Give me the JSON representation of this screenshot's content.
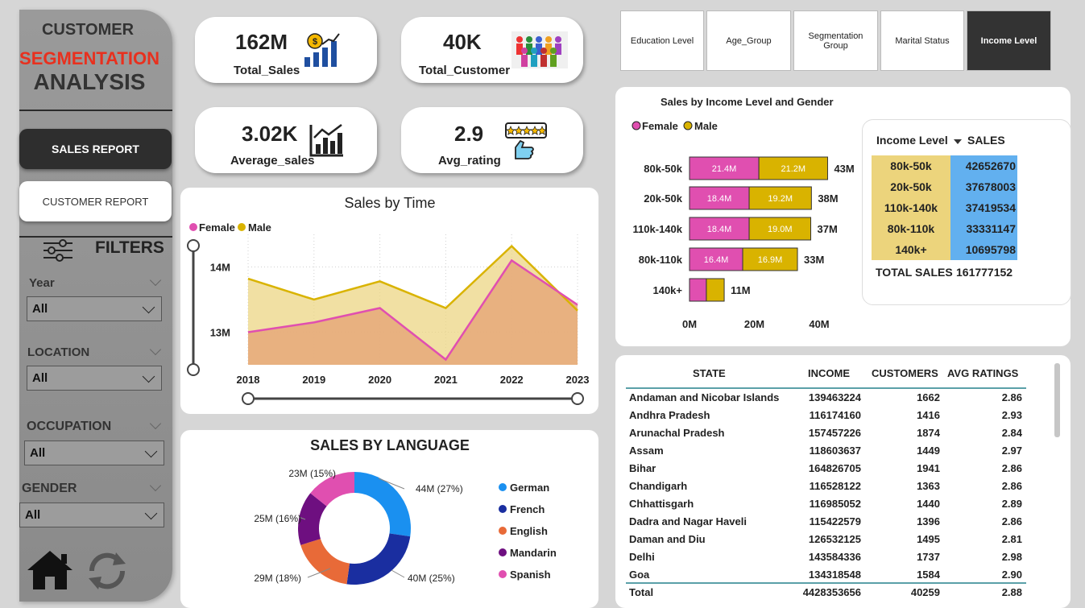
{
  "sidebar": {
    "title_line1": "CUSTOMER",
    "title_line2": "SEGMENTATION",
    "title_line3": "ANALYSIS",
    "sales_report": "SALES REPORT",
    "customer_report": "CUSTOMER REPORT",
    "filters": "FILTERS",
    "slicers": [
      {
        "label": "Year",
        "value": "All"
      },
      {
        "label": "LOCATION",
        "value": "All"
      },
      {
        "label": "OCCUPATION",
        "value": "All"
      },
      {
        "label": "GENDER",
        "value": "All"
      }
    ],
    "icons": [
      "home-icon",
      "refresh-icon",
      "sliders-icon"
    ]
  },
  "kpis": [
    {
      "value": "162M",
      "label": "Total_Sales",
      "icon": "money-growth-icon"
    },
    {
      "value": "40K",
      "label": "Total_Customer",
      "icon": "crowd-icon"
    },
    {
      "value": "3.02K",
      "label": "Average_sales",
      "icon": "bar-growth-icon"
    },
    {
      "value": "2.9",
      "label": "Avg_rating",
      "icon": "rating-hand-icon"
    }
  ],
  "tabs": [
    {
      "label": "Education Level",
      "active": false
    },
    {
      "label": "Age_Group",
      "active": false
    },
    {
      "label": "Segmentation Group",
      "active": false
    },
    {
      "label": "Marital Status",
      "active": false
    },
    {
      "label": "Income Level",
      "active": true
    }
  ],
  "colors": {
    "female": "#e04fb0",
    "male": "#d9b300",
    "highlight_yellow": "#ecd47c",
    "highlight_blue": "#62b0ef",
    "accent_red": "#e8301e"
  },
  "chart_data": [
    {
      "type": "area",
      "title": "Sales by Time",
      "series": [
        {
          "name": "Female",
          "values": [
            13.0,
            13.15,
            13.37,
            12.58,
            14.1,
            13.42
          ]
        },
        {
          "name": "Male",
          "values": [
            13.82,
            13.5,
            13.78,
            13.37,
            14.32,
            13.33
          ]
        }
      ],
      "x": [
        "2018",
        "2019",
        "2020",
        "2021",
        "2022",
        "2023"
      ],
      "yticks": [
        "13M",
        "14M"
      ],
      "ylim": [
        12.5,
        14.5
      ],
      "legend": "top-left"
    },
    {
      "type": "bar",
      "title": "Sales by Income Level and Gender",
      "categories": [
        "80k-50k",
        "20k-50k",
        "110k-140k",
        "80k-110k",
        "140k+"
      ],
      "series": [
        {
          "name": "Female",
          "values": [
            21.4,
            18.4,
            18.4,
            16.4,
            5.2
          ],
          "labels": [
            "21.4M",
            "18.4M",
            "18.4M",
            "16.4M",
            ""
          ]
        },
        {
          "name": "Male",
          "values": [
            21.2,
            19.2,
            19.0,
            16.9,
            5.5
          ],
          "labels": [
            "21.2M",
            "19.2M",
            "19.0M",
            "16.9M",
            ""
          ]
        }
      ],
      "totals": [
        "43M",
        "38M",
        "37M",
        "33M",
        "11M"
      ],
      "xticks": [
        "0M",
        "20M",
        "40M"
      ],
      "xlim": [
        0,
        50
      ],
      "legend": "top-left",
      "stacked": true
    },
    {
      "type": "pie",
      "title": "SALES BY LANGUAGE",
      "donut": true,
      "slices": [
        {
          "name": "German",
          "value": 44,
          "label": "44M (27%)",
          "color": "#1a90f0"
        },
        {
          "name": "French",
          "value": 40,
          "label": "40M (25%)",
          "color": "#1a2ea0"
        },
        {
          "name": "English",
          "value": 29,
          "label": "29M (18%)",
          "color": "#e86a38"
        },
        {
          "name": "Mandarin",
          "value": 25,
          "label": "25M (16%)",
          "color": "#6e0f80"
        },
        {
          "name": "Spanish",
          "value": 23,
          "label": "23M (15%)",
          "color": "#e04fb0"
        }
      ],
      "legend": "right"
    }
  ],
  "income_table": {
    "headers": [
      "Income Level",
      "SALES"
    ],
    "rows": [
      [
        "80k-50k",
        "42652670"
      ],
      [
        "20k-50k",
        "37678003"
      ],
      [
        "110k-140k",
        "37419534"
      ],
      [
        "80k-110k",
        "33331147"
      ],
      [
        "140k+",
        "10695798"
      ]
    ],
    "total_label": "TOTAL SALES",
    "total_value": "161777152"
  },
  "state_table": {
    "headers": [
      "STATE",
      "INCOME",
      "CUSTOMERS",
      "AVG RATINGS"
    ],
    "rows": [
      [
        "Andaman and Nicobar Islands",
        "139463224",
        "1662",
        "2.86"
      ],
      [
        "Andhra Pradesh",
        "116174160",
        "1416",
        "2.93"
      ],
      [
        "Arunachal Pradesh",
        "157457226",
        "1874",
        "2.84"
      ],
      [
        "Assam",
        "118603637",
        "1449",
        "2.97"
      ],
      [
        "Bihar",
        "164826705",
        "1941",
        "2.86"
      ],
      [
        "Chandigarh",
        "116528122",
        "1363",
        "2.86"
      ],
      [
        "Chhattisgarh",
        "116985052",
        "1440",
        "2.89"
      ],
      [
        "Dadra and Nagar Haveli",
        "115422579",
        "1396",
        "2.86"
      ],
      [
        "Daman and Diu",
        "126532125",
        "1495",
        "2.81"
      ],
      [
        "Delhi",
        "143584336",
        "1737",
        "2.98"
      ],
      [
        "Goa",
        "134318548",
        "1584",
        "2.90"
      ]
    ],
    "total": [
      "Total",
      "4428353656",
      "40259",
      "2.88"
    ]
  }
}
